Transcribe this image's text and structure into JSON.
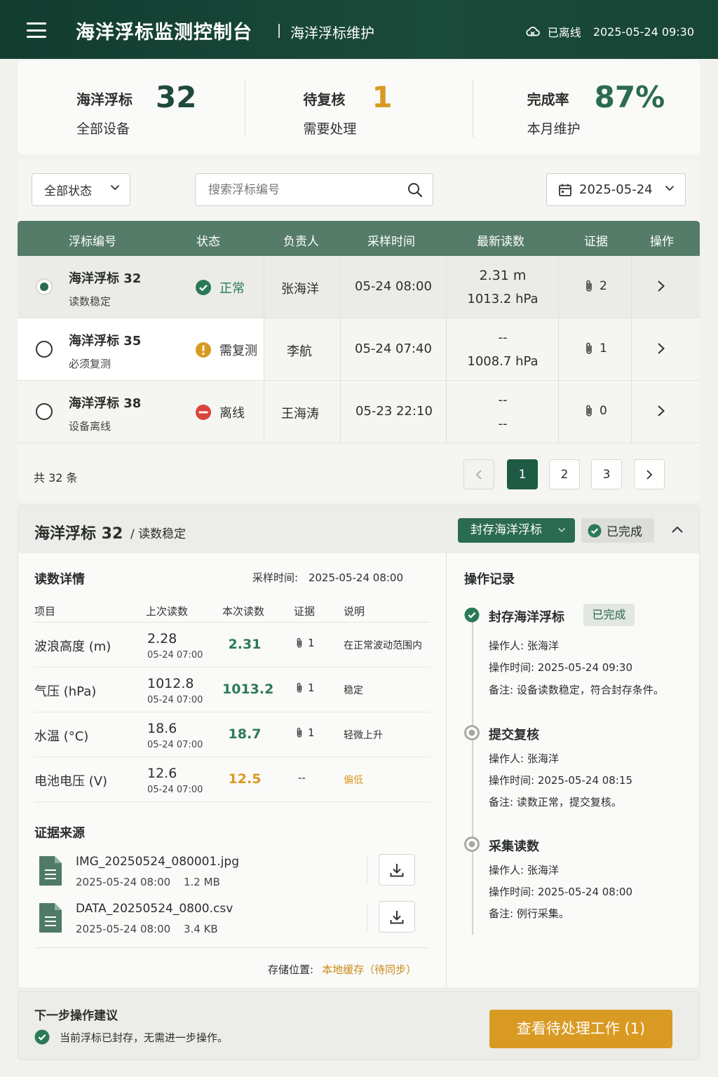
{
  "header": {
    "title": "海洋浮标监测控制台",
    "subtitle": "海洋浮标维护",
    "connection": "已离线",
    "datetime": "2025-05-24 09:30"
  },
  "summary": [
    {
      "label": "海洋浮标",
      "value": "32",
      "sub": "全部设备",
      "color": "#1f4a3a"
    },
    {
      "label": "待复核",
      "value": "1",
      "sub": "需要处理",
      "color": "#d99a23"
    },
    {
      "label": "完成率",
      "value": "87%",
      "sub": "本月维护",
      "color": "#2b6b50"
    }
  ],
  "filters": {
    "status": "全部状态",
    "search_placeholder": "搜索浮标编号",
    "date": "2025-05-24"
  },
  "table": {
    "headers": [
      "浮标编号",
      "状态",
      "负责人",
      "采样时间",
      "最新读数",
      "证据",
      "操作"
    ],
    "rows": [
      {
        "name": "海洋浮标 32",
        "note": "读数稳定",
        "status": "正常",
        "status_color": "#2b7a57",
        "owner": "张海洋",
        "time": "05-24 08:00",
        "r1": "2.31 m",
        "r2": "1013.2 hPa",
        "evidence": "2",
        "selected": true
      },
      {
        "name": "海洋浮标 35",
        "note": "必须复测",
        "status": "需复测",
        "status_color": "#d99a23",
        "owner": "李航",
        "time": "05-24 07:40",
        "r1": "--",
        "r2": "1008.7 hPa",
        "evidence": "1",
        "selected": false
      },
      {
        "name": "海洋浮标 38",
        "note": "设备离线",
        "status": "离线",
        "status_color": "#d9463e",
        "owner": "王海涛",
        "time": "05-23 22:10",
        "r1": "--",
        "r2": "--",
        "evidence": "0",
        "selected": false
      }
    ],
    "total": "共 32 条",
    "pages": [
      "1",
      "2",
      "3"
    ]
  },
  "detail": {
    "title": "海洋浮标 32",
    "subtitle": "/ 读数稳定",
    "action_button": "封存海洋浮标",
    "action_status": "已完成",
    "readings_title": "读数详情",
    "sample_label": "采样时间:",
    "sample_time": "2025-05-24 08:00",
    "columns": [
      "项目",
      "上次读数",
      "本次读数",
      "证据",
      "说明"
    ],
    "readings": [
      {
        "item": "波浪高度 (m)",
        "prev": "2.28",
        "prev_time": "05-24 07:00",
        "cur": "2.31",
        "evidence": "1",
        "desc": "在正常波动范围内",
        "cur_color": "#2b7a57",
        "desc_color": "#2b2f2c"
      },
      {
        "item": "气压 (hPa)",
        "prev": "1012.8",
        "prev_time": "05-24 07:00",
        "cur": "1013.2",
        "evidence": "1",
        "desc": "稳定",
        "cur_color": "#2b7a57",
        "desc_color": "#2b2f2c"
      },
      {
        "item": "水温 (°C)",
        "prev": "18.6",
        "prev_time": "05-24 07:00",
        "cur": "18.7",
        "evidence": "1",
        "desc": "轻微上升",
        "cur_color": "#2b7a57",
        "desc_color": "#2b2f2c"
      },
      {
        "item": "电池电压 (V)",
        "prev": "12.6",
        "prev_time": "05-24 07:00",
        "cur": "12.5",
        "evidence": "--",
        "desc": "偏低",
        "cur_color": "#d99a23",
        "desc_color": "#d99a23"
      }
    ],
    "evidence_title": "证据来源",
    "files": [
      {
        "name": "IMG_20250524_080001.jpg",
        "date": "2025-05-24 08:00",
        "size": "1.2 MB"
      },
      {
        "name": "DATA_20250524_0800.csv",
        "date": "2025-05-24 08:00",
        "size": "3.4 KB"
      }
    ],
    "storage_label": "存储位置:",
    "storage_value": "本地缓存（待同步）",
    "log_title": "操作记录",
    "log": [
      {
        "title": "封存海洋浮标",
        "badge": "已完成",
        "operator": "操作人: 张海洋",
        "time": "操作时间: 2025-05-24 09:30",
        "note": "备注: 设备读数稳定，符合封存条件。"
      },
      {
        "title": "提交复核",
        "operator": "操作人: 张海洋",
        "time": "操作时间: 2025-05-24 08:15",
        "note": "备注: 读数正常，提交复核。"
      },
      {
        "title": "采集读数",
        "operator": "操作人: 张海洋",
        "time": "操作时间: 2025-05-24 08:00",
        "note": "备注: 例行采集。"
      }
    ]
  },
  "next": {
    "title": "下一步操作建议",
    "message": "当前浮标已封存，无需进一步操作。",
    "button": "查看待处理工作 (1)"
  }
}
